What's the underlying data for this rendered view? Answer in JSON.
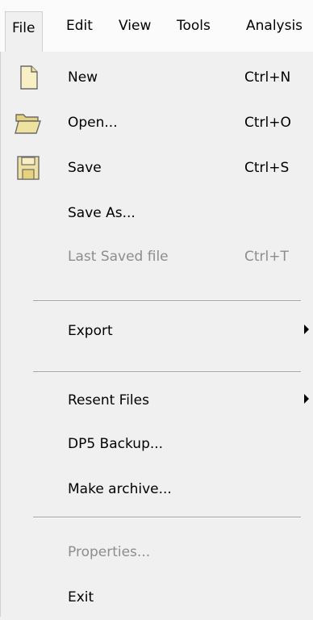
{
  "menubar": {
    "items": [
      {
        "label": "File"
      },
      {
        "label": "Edit"
      },
      {
        "label": "View"
      },
      {
        "label": "Tools"
      },
      {
        "label": "Analysis"
      }
    ]
  },
  "file_menu": {
    "new": {
      "label": "New",
      "shortcut": "Ctrl+N",
      "icon": "new-file-icon"
    },
    "open": {
      "label": "Open...",
      "shortcut": "Ctrl+O",
      "icon": "folder-icon"
    },
    "save": {
      "label": "Save",
      "shortcut": "Ctrl+S",
      "icon": "floppy-disk-icon"
    },
    "save_as": {
      "label": "Save As..."
    },
    "last_saved": {
      "label": "Last Saved file",
      "shortcut": "Ctrl+T",
      "enabled": false
    },
    "export": {
      "label": "Export",
      "has_submenu": true
    },
    "recent_files": {
      "label": "Resent Files",
      "has_submenu": true
    },
    "dp5_backup": {
      "label": "DP5 Backup..."
    },
    "make_archive": {
      "label": "Make archive..."
    },
    "properties": {
      "label": "Properties...",
      "enabled": false
    },
    "exit": {
      "label": "Exit"
    }
  }
}
